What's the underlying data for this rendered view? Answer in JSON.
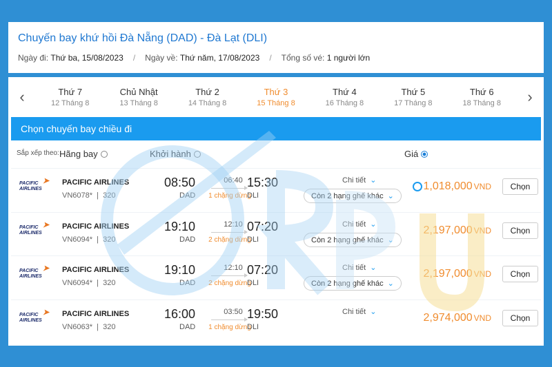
{
  "header": {
    "title": "Chuyến bay khứ hồi Đà Nẵng (DAD) - Đà Lạt (DLI)",
    "depart_label": "Ngày đi:",
    "depart_value": "Thứ ba, 15/08/2023",
    "return_label": "Ngày về:",
    "return_value": "Thứ năm, 17/08/2023",
    "tickets_label": "Tổng số vé:",
    "tickets_value": "1 người lớn",
    "sep": "/"
  },
  "dates": [
    {
      "day": "Thứ 7",
      "date": "12 Tháng 8"
    },
    {
      "day": "Chủ Nhật",
      "date": "13 Tháng 8"
    },
    {
      "day": "Thứ 2",
      "date": "14 Tháng 8"
    },
    {
      "day": "Thứ 3",
      "date": "15 Tháng 8",
      "active": true
    },
    {
      "day": "Thứ 4",
      "date": "16 Tháng 8"
    },
    {
      "day": "Thứ 5",
      "date": "17 Tháng 8"
    },
    {
      "day": "Thứ 6",
      "date": "18 Tháng 8"
    }
  ],
  "nav": {
    "prev": "‹",
    "next": "›"
  },
  "banner": "Chọn chuyến bay chiều đi",
  "sort": {
    "label": "Sắp xếp theo:",
    "airline": "Hãng bay",
    "departure": "Khởi hành",
    "price": "Giá"
  },
  "flights": [
    {
      "airline": "PACIFIC AIRLINES",
      "code": "VN6078*",
      "aircraft": "320",
      "dep_time": "08:50",
      "dep_code": "DAD",
      "duration": "06:40",
      "stops": "1 chặng dừng",
      "arr_time": "15:30",
      "arr_code": "DLI",
      "detail": "Chi tiết",
      "seats": "Còn 2 hạng ghế khác",
      "price": "1,018,000",
      "currency": "VND",
      "button": "Chọn"
    },
    {
      "airline": "PACIFIC AIRLINES",
      "code": "VN6094*",
      "aircraft": "320",
      "dep_time": "19:10",
      "dep_code": "DAD",
      "duration": "12:10",
      "stops": "2 chặng dừng",
      "arr_time": "07:20",
      "arr_code": "DLI",
      "detail": "Chi tiết",
      "seats": "Còn 2 hạng ghế khác",
      "price": "2,197,000",
      "currency": "VND",
      "button": "Chọn"
    },
    {
      "airline": "PACIFIC AIRLINES",
      "code": "VN6094*",
      "aircraft": "320",
      "dep_time": "19:10",
      "dep_code": "DAD",
      "duration": "12:10",
      "stops": "2 chặng dừng",
      "arr_time": "07:20",
      "arr_code": "DLI",
      "detail": "Chi tiết",
      "seats": "Còn 2 hạng ghế khác",
      "price": "2,197,000",
      "currency": "VND",
      "button": "Chọn"
    },
    {
      "airline": "PACIFIC AIRLINES",
      "code": "VN6063*",
      "aircraft": "320",
      "dep_time": "16:00",
      "dep_code": "DAD",
      "duration": "03:50",
      "stops": "1 chặng dừng",
      "arr_time": "19:50",
      "arr_code": "DLI",
      "detail": "Chi tiết",
      "seats": "",
      "price": "2,974,000",
      "currency": "VND",
      "button": "Chọn"
    }
  ],
  "logo": {
    "line1": "PACIFIC",
    "line2": "AIRLINES"
  },
  "colors": {
    "accent": "#1a9bef",
    "price": "#f08c2e",
    "background": "#2f8fd4"
  }
}
